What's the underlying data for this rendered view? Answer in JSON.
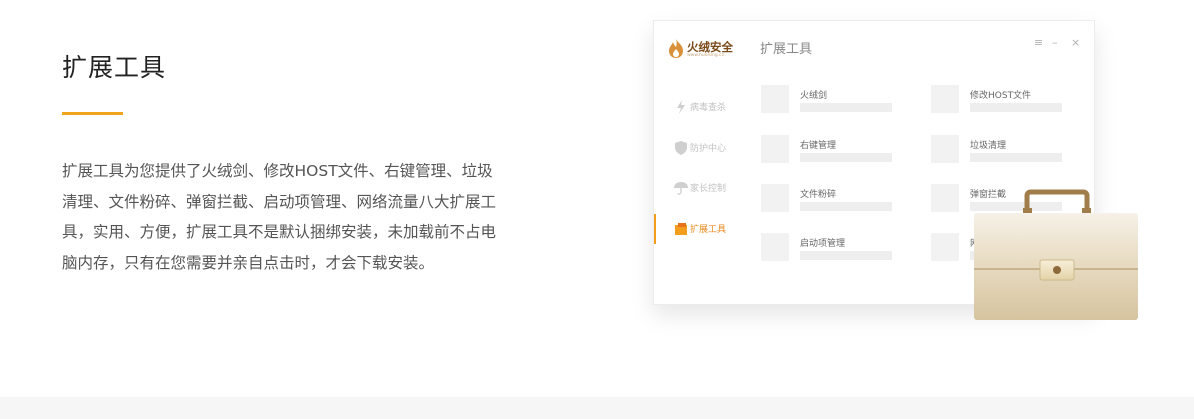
{
  "section": {
    "title": "扩展工具",
    "description": "扩展工具为您提供了火绒剑、修改HOST文件、右键管理、垃圾清理、文件粉碎、弹窗拦截、启动项管理、网络流量八大扩展工具，实用、方便，扩展工具不是默认捆绑安装，未加载前不占电脑内存，只有在您需要并亲自点击时，才会下载安装。"
  },
  "app": {
    "logo_text": "火绒安全",
    "logo_sub": "www.huorong.cn",
    "window_title": "扩展工具",
    "controls": {
      "menu": "≡",
      "minimize": "–",
      "close": "×"
    },
    "sidebar": [
      {
        "label": "病毒查杀",
        "icon": "lightning-icon"
      },
      {
        "label": "防护中心",
        "icon": "shield-icon"
      },
      {
        "label": "家长控制",
        "icon": "umbrella-icon"
      },
      {
        "label": "扩展工具",
        "icon": "toolbox-icon",
        "active": true
      }
    ],
    "tools": [
      {
        "label": "火绒剑"
      },
      {
        "label": "修改HOST文件"
      },
      {
        "label": "右键管理"
      },
      {
        "label": "垃圾清理"
      },
      {
        "label": "文件粉碎"
      },
      {
        "label": "弹窗拦截"
      },
      {
        "label": "启动项管理"
      },
      {
        "label": "网"
      }
    ]
  },
  "colors": {
    "accent": "#f0a31b",
    "active_text": "#e88a1c",
    "briefcase_body": "#e2d3b4",
    "briefcase_handle": "#a17d4b"
  }
}
